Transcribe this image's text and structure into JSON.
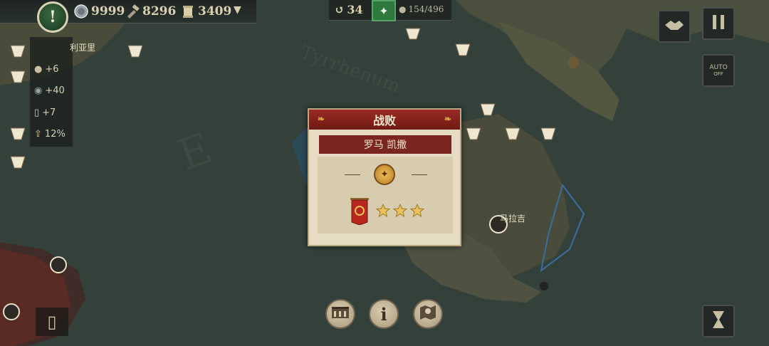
{
  "resources": {
    "silver": "9999",
    "tools": "8296",
    "scrolls": "3409",
    "supply": "34",
    "population": "154/496"
  },
  "city": {
    "name": "利亚里",
    "name_east": "马拉吉"
  },
  "stats": {
    "population_bonus": "+6",
    "silver_bonus": "+40",
    "scroll_bonus": "+7",
    "growth": "12%"
  },
  "dialog": {
    "title": "战败",
    "general": "罗马 凯撒",
    "stars": 3
  },
  "map_labels": {
    "sea": "Tyrrhenum",
    "region": "E"
  },
  "buttons": {
    "auto_line1": "AUTO",
    "auto_line2": "OFF",
    "info": "i"
  },
  "colors": {
    "header_red": "#8a241e",
    "parchment": "#e6dcc3",
    "gold": "#e8c15a"
  },
  "icons": {
    "alert": "exclamation-icon",
    "pause": "pause-icon",
    "diplomacy": "handshake-icon",
    "auto": "crossed-swords-icon",
    "senate": "colosseum-icon",
    "info": "info-icon",
    "map": "map-icon",
    "end_turn": "hourglass-icon"
  }
}
